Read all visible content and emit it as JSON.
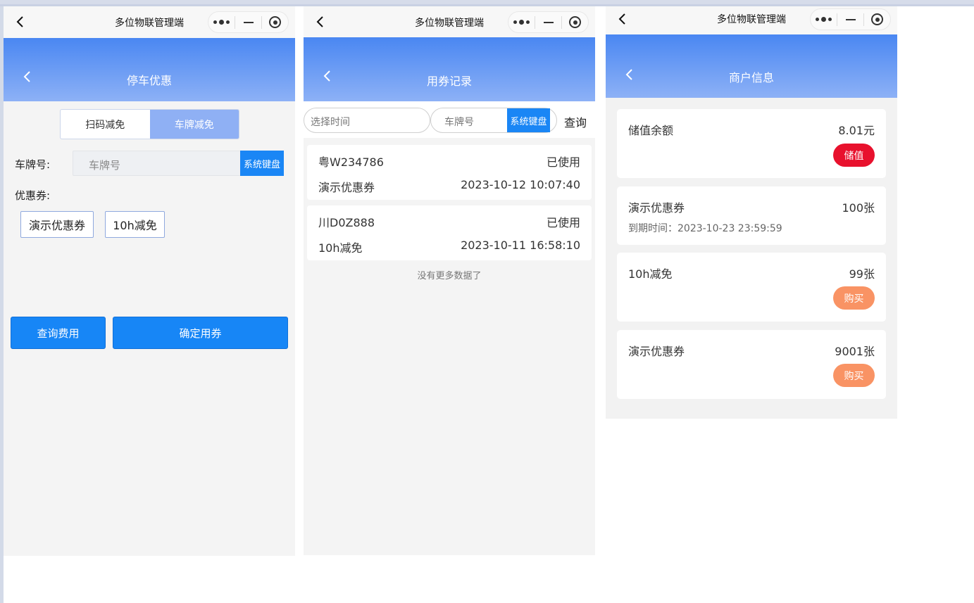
{
  "app_title": "多位物联管理端",
  "screens": {
    "parking_discount": {
      "header": "停车优惠",
      "tabs": [
        "扫码减免",
        "车牌减免"
      ],
      "plate_label": "车牌号:",
      "plate_placeholder": "车牌号",
      "keyboard_btn": "系统键盘",
      "coupon_label": "优惠券:",
      "coupons": [
        "演示优惠券",
        "10h减免"
      ],
      "query_btn": "查询费用",
      "confirm_btn": "确定用券"
    },
    "coupon_records": {
      "header": "用券记录",
      "time_placeholder": "选择时间",
      "plate_placeholder": "车牌号",
      "keyboard_btn": "系统键盘",
      "query": "查询",
      "records": [
        {
          "plate": "粤W234786",
          "status": "已使用",
          "coupon": "演示优惠券",
          "time": "2023-10-12 10:07:40"
        },
        {
          "plate": "川D0Z888",
          "status": "已使用",
          "coupon": "10h减免",
          "time": "2023-10-11 16:58:10"
        }
      ],
      "no_more": "没有更多数据了"
    },
    "merchant_info": {
      "header": "商户信息",
      "balance_label": "储值余额",
      "balance_value": "8.01元",
      "topup_btn": "储值",
      "items": [
        {
          "name": "演示优惠券",
          "count": "100张",
          "expire": "到期时间：2023-10-23 23:59:59"
        },
        {
          "name": "10h减免",
          "count": "99张",
          "button": "购买"
        },
        {
          "name": "演示优惠券",
          "count": "9001张",
          "button": "购买"
        }
      ]
    }
  },
  "colors": {
    "header_start": "#4a87f2",
    "header_end": "#8db1f6",
    "primary": "#1786f6",
    "red": "#e8112d",
    "orange": "#f99364"
  }
}
